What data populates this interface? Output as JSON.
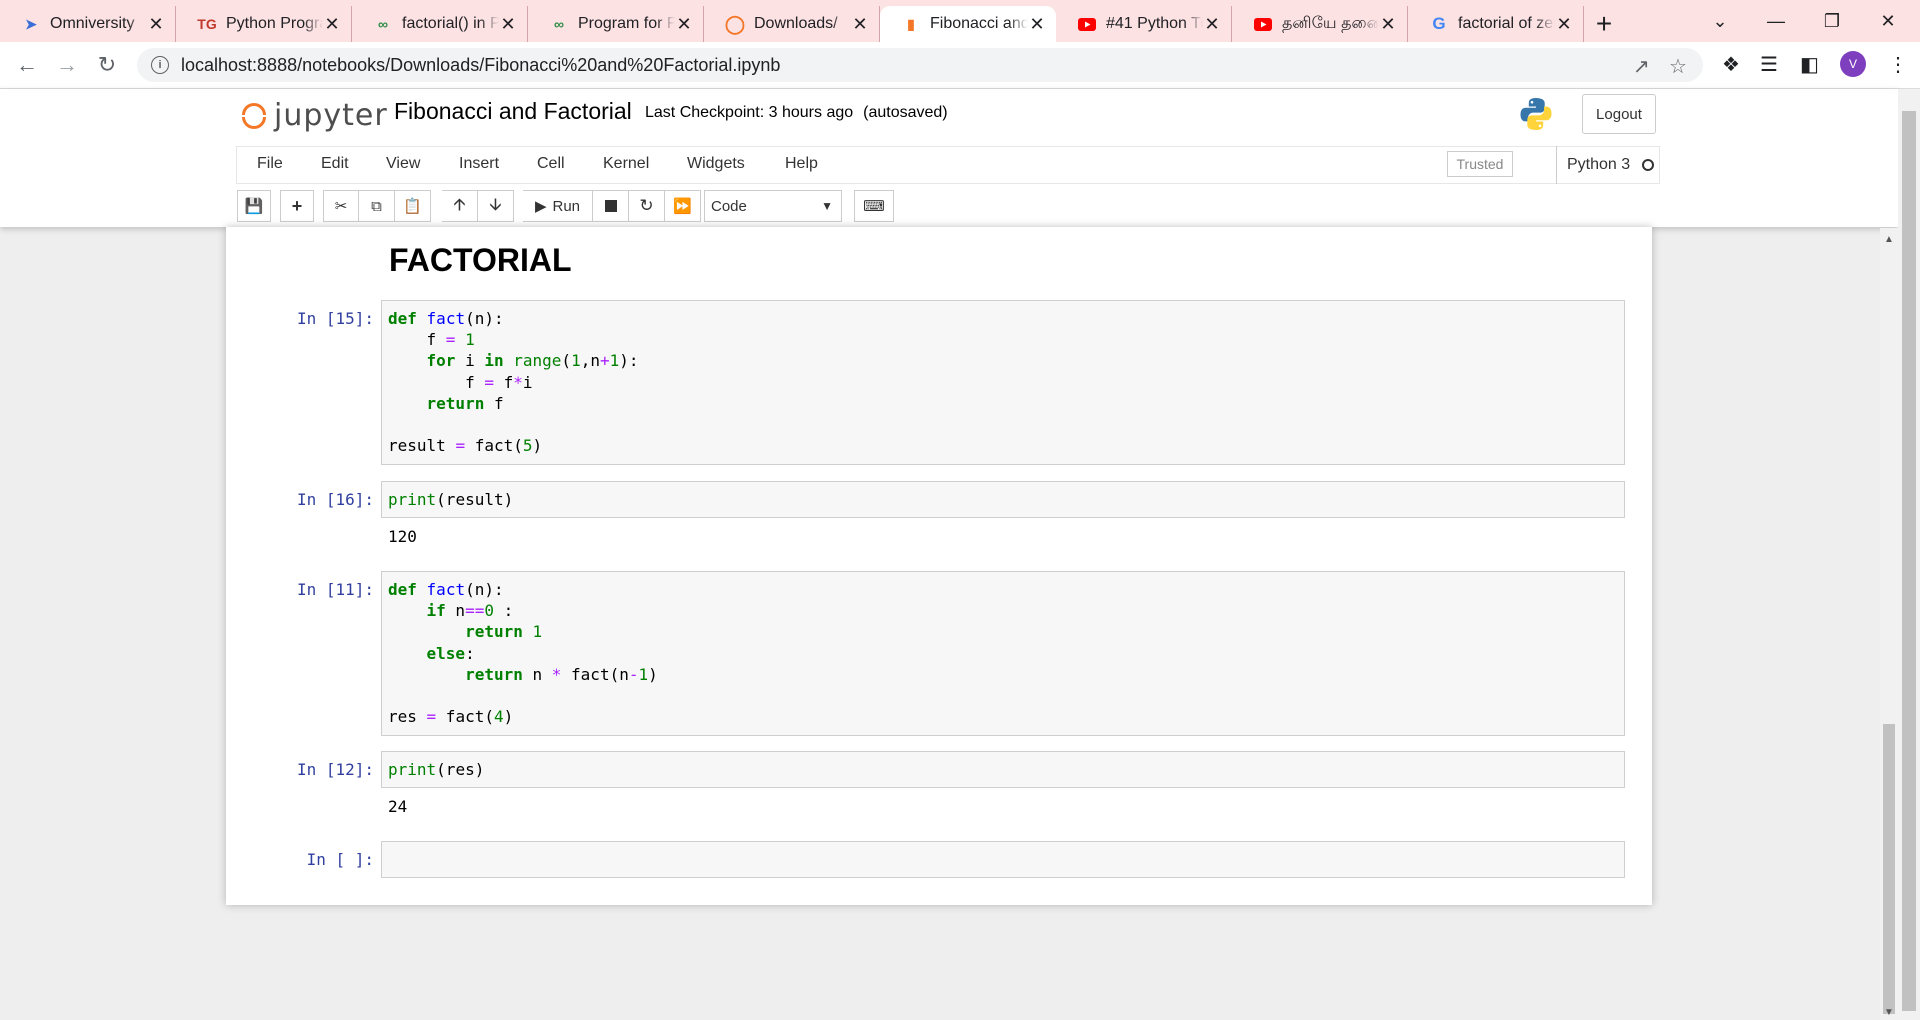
{
  "tabs": [
    {
      "title": "Omniversity",
      "icon": "omniversity-icon",
      "active": false
    },
    {
      "title": "Python Programming",
      "icon": "tg-icon",
      "active": false
    },
    {
      "title": "factorial() in Python",
      "icon": "geeks-icon",
      "active": false
    },
    {
      "title": "Program for Fibonacci",
      "icon": "geeks-icon",
      "active": false
    },
    {
      "title": "Downloads/",
      "icon": "jupyter-icon",
      "active": false
    },
    {
      "title": "Fibonacci and Factorial",
      "icon": "notebook-icon",
      "active": true
    },
    {
      "title": "#41 Python Tutorial",
      "icon": "youtube-icon",
      "active": false
    },
    {
      "title": "தனியே தனை",
      "icon": "youtube-icon",
      "active": false
    },
    {
      "title": "factorial of zero",
      "icon": "google-icon",
      "active": false
    }
  ],
  "browser": {
    "url": "localhost:8888/notebooks/Downloads/Fibonacci%20and%20Factorial.ipynb",
    "avatar_letter": "V"
  },
  "jupyter": {
    "logo_text": "jupyter",
    "notebook_title": "Fibonacci and Factorial",
    "checkpoint": "Last Checkpoint: 3 hours ago",
    "autosaved": "(autosaved)",
    "logout_label": "Logout",
    "menu": [
      "File",
      "Edit",
      "View",
      "Insert",
      "Cell",
      "Kernel",
      "Widgets",
      "Help"
    ],
    "trusted_label": "Trusted",
    "kernel_name": "Python 3",
    "run_label": "Run",
    "cell_type": "Code"
  },
  "notebook": {
    "heading": "FACTORIAL",
    "cells": [
      {
        "prompt": "In [15]:",
        "output": ""
      },
      {
        "prompt": "In [16]:",
        "output": "120"
      },
      {
        "prompt": "In [11]:",
        "output": ""
      },
      {
        "prompt": "In [12]:",
        "output": "24"
      },
      {
        "prompt": "In [ ]:",
        "output": ""
      }
    ]
  },
  "colors": {
    "tabstrip_bg": "#fde2e4",
    "jupyter_orange": "#f37726",
    "prompt_blue": "#303f9f",
    "keyword_green": "#008000"
  }
}
